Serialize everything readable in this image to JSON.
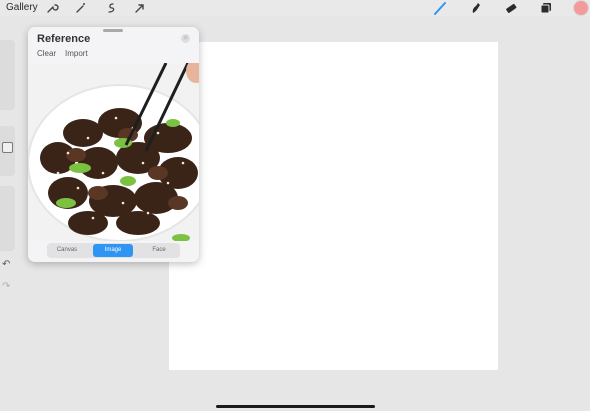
{
  "topbar": {
    "gallery_label": "Gallery",
    "tools_left": [
      "wrench-icon",
      "magic-wand-icon",
      "selection-icon",
      "move-arrow-icon"
    ],
    "tools_right": [
      "brush-icon",
      "smudge-icon",
      "eraser-icon",
      "layers-icon"
    ],
    "color_swatch": "#f39b9b"
  },
  "reference": {
    "title": "Reference",
    "clear_label": "Clear",
    "import_label": "Import",
    "tabs": [
      {
        "label": "Canvas",
        "active": false
      },
      {
        "label": "Image",
        "active": true
      },
      {
        "label": "Face",
        "active": false
      }
    ],
    "accent_color": "#2f95f2"
  },
  "sidebar": {
    "undo_icon": "undo-icon",
    "redo_icon": "redo-icon"
  }
}
